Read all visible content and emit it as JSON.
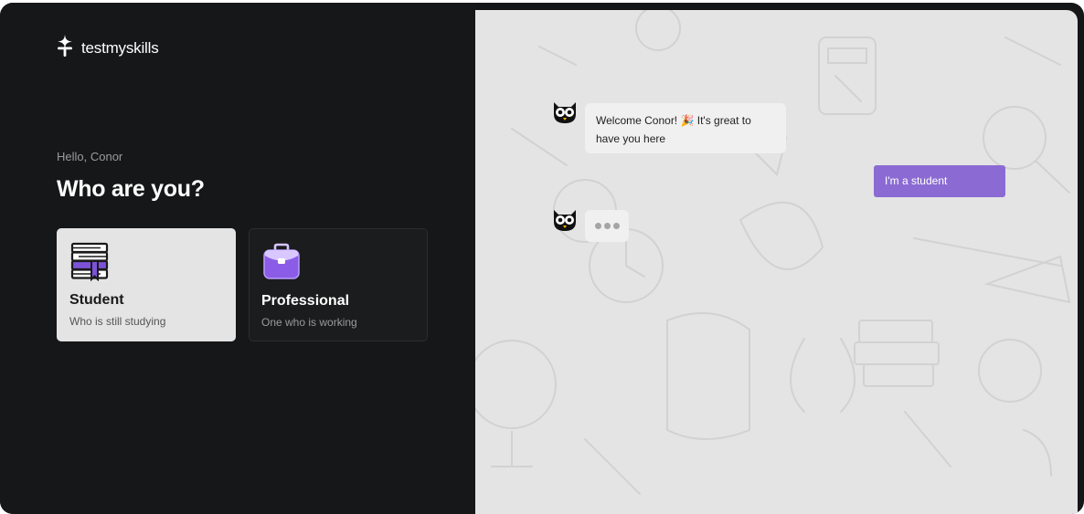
{
  "brand": {
    "name": "testmyskills",
    "icon": "sparkle-logo-icon"
  },
  "onboarding": {
    "greeting": "Hello, Conor",
    "question": "Who are you?",
    "options": [
      {
        "title": "Student",
        "subtitle": "Who is still studying",
        "icon": "books-icon",
        "selected": true
      },
      {
        "title": "Professional",
        "subtitle": "One who is working",
        "icon": "briefcase-icon",
        "selected": false
      }
    ]
  },
  "chat": {
    "bot_avatar_icon": "owl-icon",
    "messages": [
      {
        "from": "bot",
        "text": "Welcome Conor! 🎉 It's great to have you here"
      },
      {
        "from": "user",
        "text": "I'm a student"
      },
      {
        "from": "bot",
        "typing": true
      }
    ]
  },
  "colors": {
    "panel_dark": "#161718",
    "accent": "#8b6bd3",
    "chat_bg": "#e4e4e4",
    "bubble": "#f0f0f0"
  }
}
